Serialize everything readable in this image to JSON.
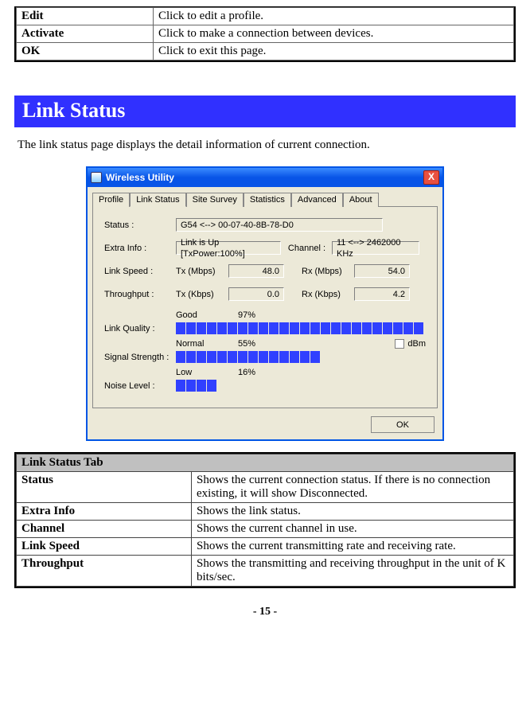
{
  "top_table": {
    "rows": [
      {
        "label": "Edit",
        "desc": "Click to edit a profile."
      },
      {
        "label": "Activate",
        "desc": "Click to make a connection between devices."
      },
      {
        "label": "OK",
        "desc": "Click to exit this page."
      }
    ]
  },
  "section_title": "Link Status",
  "intro_text": "The link status page displays the detail information of current connection.",
  "dialog": {
    "window_title": "Wireless Utility",
    "close_label": "X",
    "tabs": [
      "Profile",
      "Link Status",
      "Site Survey",
      "Statistics",
      "Advanced",
      "About"
    ],
    "active_tab_index": 1,
    "labels": {
      "status": "Status :",
      "extra_info": "Extra Info :",
      "channel": "Channel :",
      "link_speed": "Link Speed :",
      "throughput": "Throughput :",
      "tx_mbps": "Tx (Mbps)",
      "rx_mbps": "Rx (Mbps)",
      "tx_kbps": "Tx (Kbps)",
      "rx_kbps": "Rx (Kbps)",
      "link_quality": "Link Quality :",
      "signal_strength": "Signal Strength :",
      "noise_level": "Noise Level :",
      "good": "Good",
      "normal": "Normal",
      "low": "Low",
      "dbm": "dBm"
    },
    "values": {
      "status": "G54 <--> 00-07-40-8B-78-D0",
      "extra_info": "Link is Up [TxPower:100%]",
      "channel": "11 <--> 2462000 KHz",
      "tx_mbps": "48.0",
      "rx_mbps": "54.0",
      "tx_kbps": "0.0",
      "rx_kbps": "4.2",
      "good_pct": "97%",
      "normal_pct": "55%",
      "low_pct": "16%"
    },
    "bars": {
      "link_quality_segments": 24,
      "link_quality_total": 25,
      "signal_strength_segments": 14,
      "signal_strength_total": 25,
      "noise_level_segments": 4,
      "noise_level_total": 25
    },
    "ok_button": "OK"
  },
  "bottom_table": {
    "header": "Link Status Tab",
    "rows": [
      {
        "label": "Status",
        "desc": "Shows the current connection status. If there is no connection existing, it will show Disconnected."
      },
      {
        "label": "Extra Info",
        "desc": "Shows the link status."
      },
      {
        "label": "Channel",
        "desc": "Shows the current channel in use."
      },
      {
        "label": "Link Speed",
        "desc": "Shows the current transmitting rate and receiving rate."
      },
      {
        "label": "Throughput",
        "desc": "Shows the transmitting and receiving throughput in the unit of K bits/sec."
      }
    ]
  },
  "page_number": "- 15 -"
}
